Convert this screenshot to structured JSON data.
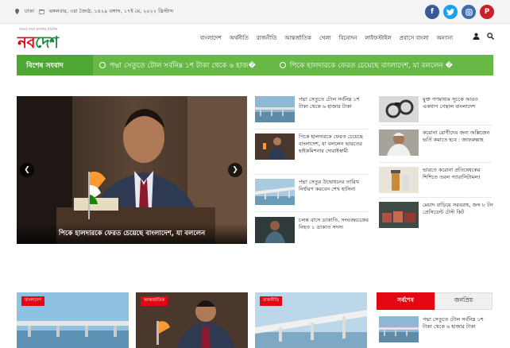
{
  "topbar": {
    "location": "ঢাকা",
    "date": "মঙ্গলবার, ৩রা জ্যৈষ্ঠ, ১৪২৯ বঙ্গাব্দ, ১৭ই মে, ২০২২ খ্রিস্টাব্দ",
    "socials": [
      "facebook-icon",
      "twitter-icon",
      "instagram-icon",
      "pinterest-icon"
    ]
  },
  "logo": {
    "tagline": "সত্যের সাথে আপনার প্রতিদিন",
    "part1": "নব",
    "part2": "দেশ"
  },
  "nav": {
    "items": [
      "বাংলাদেশ",
      "অর্থনীতি",
      "রাজনীতি",
      "আন্তর্জাতিক",
      "খেলা",
      "বিনোদন",
      "লাইফস্টাইল",
      "প্রবাসে বাংলা",
      "অন্যান্য"
    ]
  },
  "ticker": {
    "label": "বিশেষ সংবাদ",
    "items": [
      "পদ্মা সেতুতে টোল সর্বনিম্ন ১শ টাকা থেকে ৬ হাজ�",
      "পিকে হালদারকে ফেরত চেয়েছে বাংলাদেশ, যা বললেন �"
    ]
  },
  "hero": {
    "caption": "পিকে হালদারকে ফেরত চেয়েছে বাংলাদেশ, যা বললেন"
  },
  "col2": [
    "পদ্মা সেতুতে টোল সর্বনিম্ন ১শ টাকা থেকে ৬ হাজার টাকা",
    "পিকে হালদারকে ফেরত চেয়েছে বাংলাদেশ, যা বললেন ভারতের হাইকমিশনার দোরাইস্বামী",
    "পদ্মা সেতুর উদ্বোধনের তারিখ নির্ধারণ করবেন শেখ হাসিনা",
    "চলন্ত বাসে ডাকাতি, সংঘবদ্ধচক্রের নিহত ১ ডাকাত সদস্য"
  ],
  "col3": [
    "মুক্ত গণমাধ্যম সূচকে আরও একধাপ পেছাল বাংলাদেশ",
    "করোনা রোগীদের জন্য অক্সিজেন ভর্তি কমাতে হবে : জাফরুল্লাহ",
    "ভারতে করোনা প্রতিষেধকের শিশিতে তরল প্যারাসিটামল!",
    "মেয়াদ বাড়িয়ে সরবরাহ, জব্দ ৮ টন প্রেসিডেন্ট টেস্ট কিট"
  ],
  "bottom": {
    "badges": [
      "বাংলাদেশ",
      "আন্তর্জাতিক",
      "রাজনীতি"
    ],
    "tabs": [
      "সর্বশেষ",
      "জনপ্রিয়"
    ],
    "side_item": "পদ্মা সেতুতে টোল সর্বনিম্ন ১শ টাকা থেকে ৬ হাজার টাকা"
  },
  "colors": {
    "brand_red": "#e30613",
    "brand_green": "#1a8a3c",
    "ticker_green": "#68b845"
  }
}
